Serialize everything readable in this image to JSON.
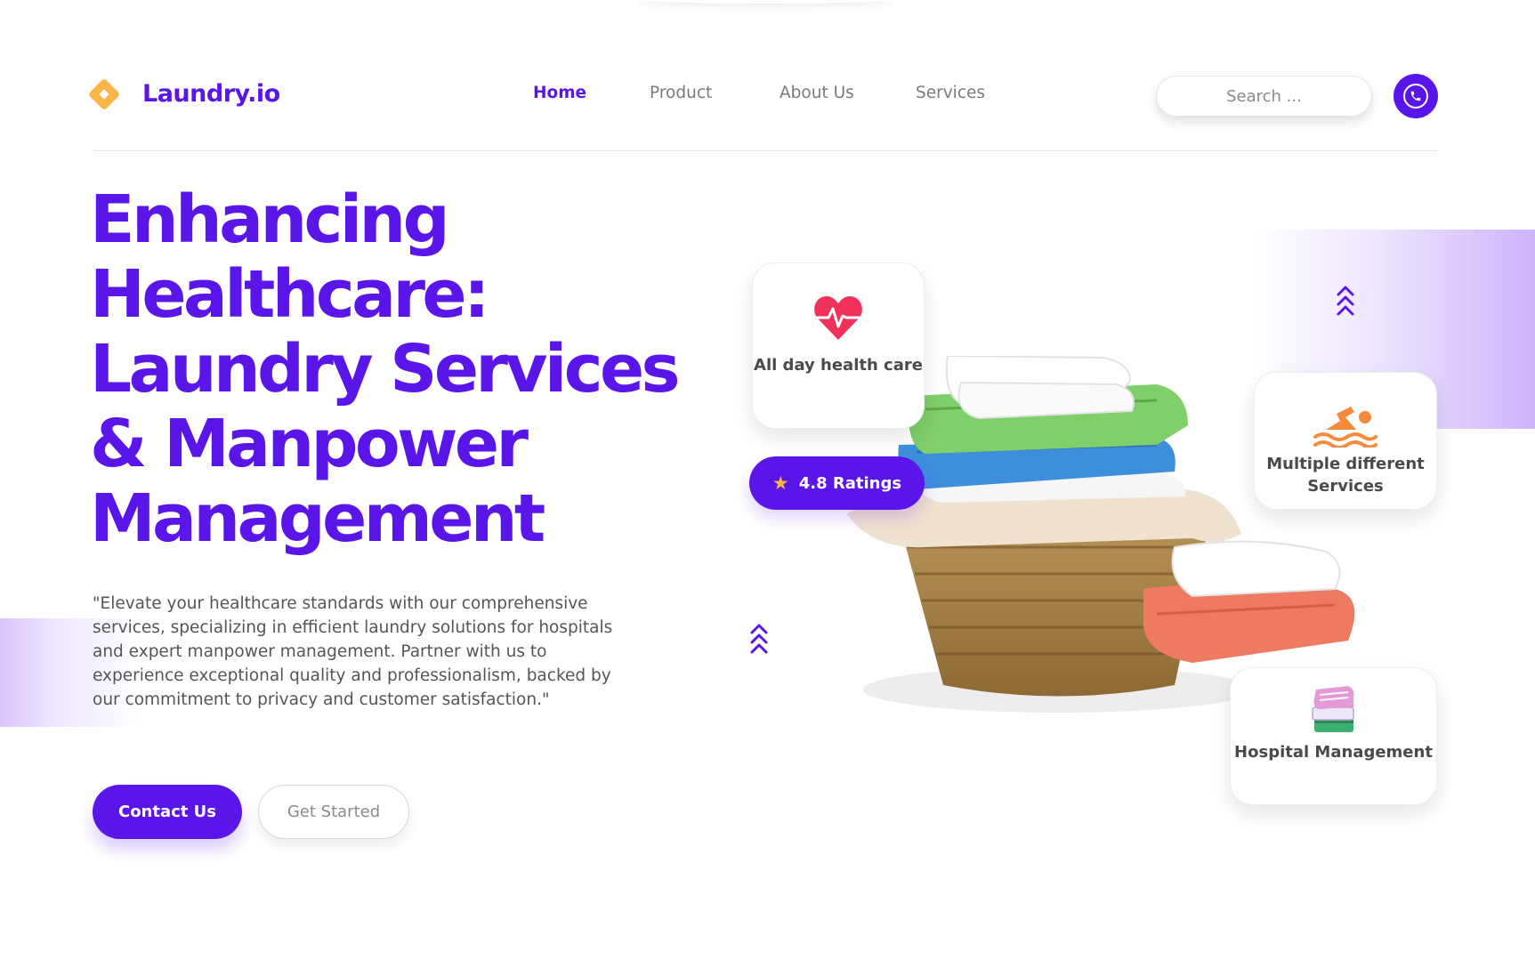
{
  "brand": {
    "name": "Laundry.io",
    "accent": "#5a16e8",
    "logo_color": "#f9b547"
  },
  "nav": {
    "items": [
      {
        "label": "Home",
        "active": true
      },
      {
        "label": "Product",
        "active": false
      },
      {
        "label": "About Us",
        "active": false
      },
      {
        "label": "Services",
        "active": false
      }
    ]
  },
  "search": {
    "placeholder": "Search ..."
  },
  "phone": {
    "icon": "phone-icon"
  },
  "hero": {
    "title_lines": [
      "Enhancing",
      "Healthcare:",
      "Laundry Services",
      "& Manpower",
      "Management"
    ],
    "description": "\"Elevate your healthcare standards with our comprehensive services, specializing in efficient laundry solutions for hospitals and expert manpower management. Partner with us to experience exceptional quality and professionalism, backed by our commitment to privacy and customer satisfaction.\"",
    "primary_button": "Contact Us",
    "secondary_button": "Get Started"
  },
  "features": {
    "health": {
      "label": "All day health care",
      "icon": "heart-pulse-icon",
      "icon_color": "#f0325a"
    },
    "ratings": {
      "label": "4.8 Ratings",
      "icon": "star-icon"
    },
    "services": {
      "label": "Multiple different Services",
      "icon": "swimmer-icon",
      "icon_color": "#f58a3c"
    },
    "hospital": {
      "label": "Hospital Management",
      "icon": "stacked-books-icon"
    }
  },
  "decor": {
    "chevrons_icon": "chevrons-up-icon",
    "image": "laundry-basket-with-towels"
  }
}
